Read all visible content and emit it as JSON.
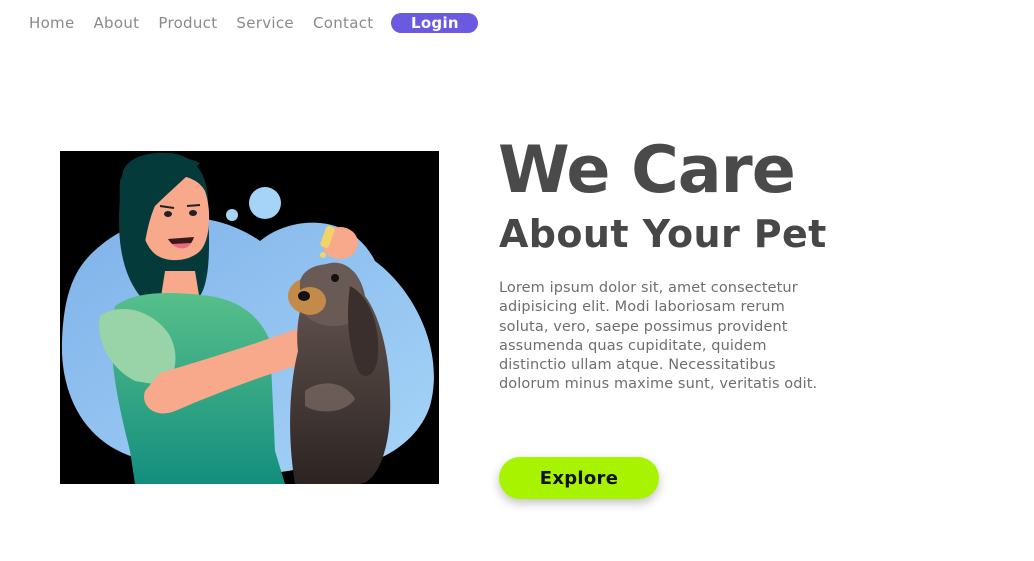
{
  "nav": {
    "links": [
      "Home",
      "About",
      "Product",
      "Service",
      "Contact"
    ],
    "login_label": "Login"
  },
  "hero": {
    "headline": "We Care",
    "subheadline": "About Your Pet",
    "description": "Lorem ipsum dolor sit, amet consectetur adipisicing elit. Modi laboriosam rerum soluta, vero, saepe possimus provident assumenda quas cupiditate, quidem distinctio ullam atque. Necessitatibus dolorum minus maxime sunt, veritatis odit.",
    "cta_label": "Explore"
  },
  "illustration": {
    "subject": "woman-giving-eye-drops-to-dog"
  },
  "colors": {
    "login_bg": "#6a5ae0",
    "cta_bg": "#a8f400",
    "headline": "#4a4a4a",
    "nav_text": "#8a8a8a",
    "illustration_bg": "#000000"
  }
}
